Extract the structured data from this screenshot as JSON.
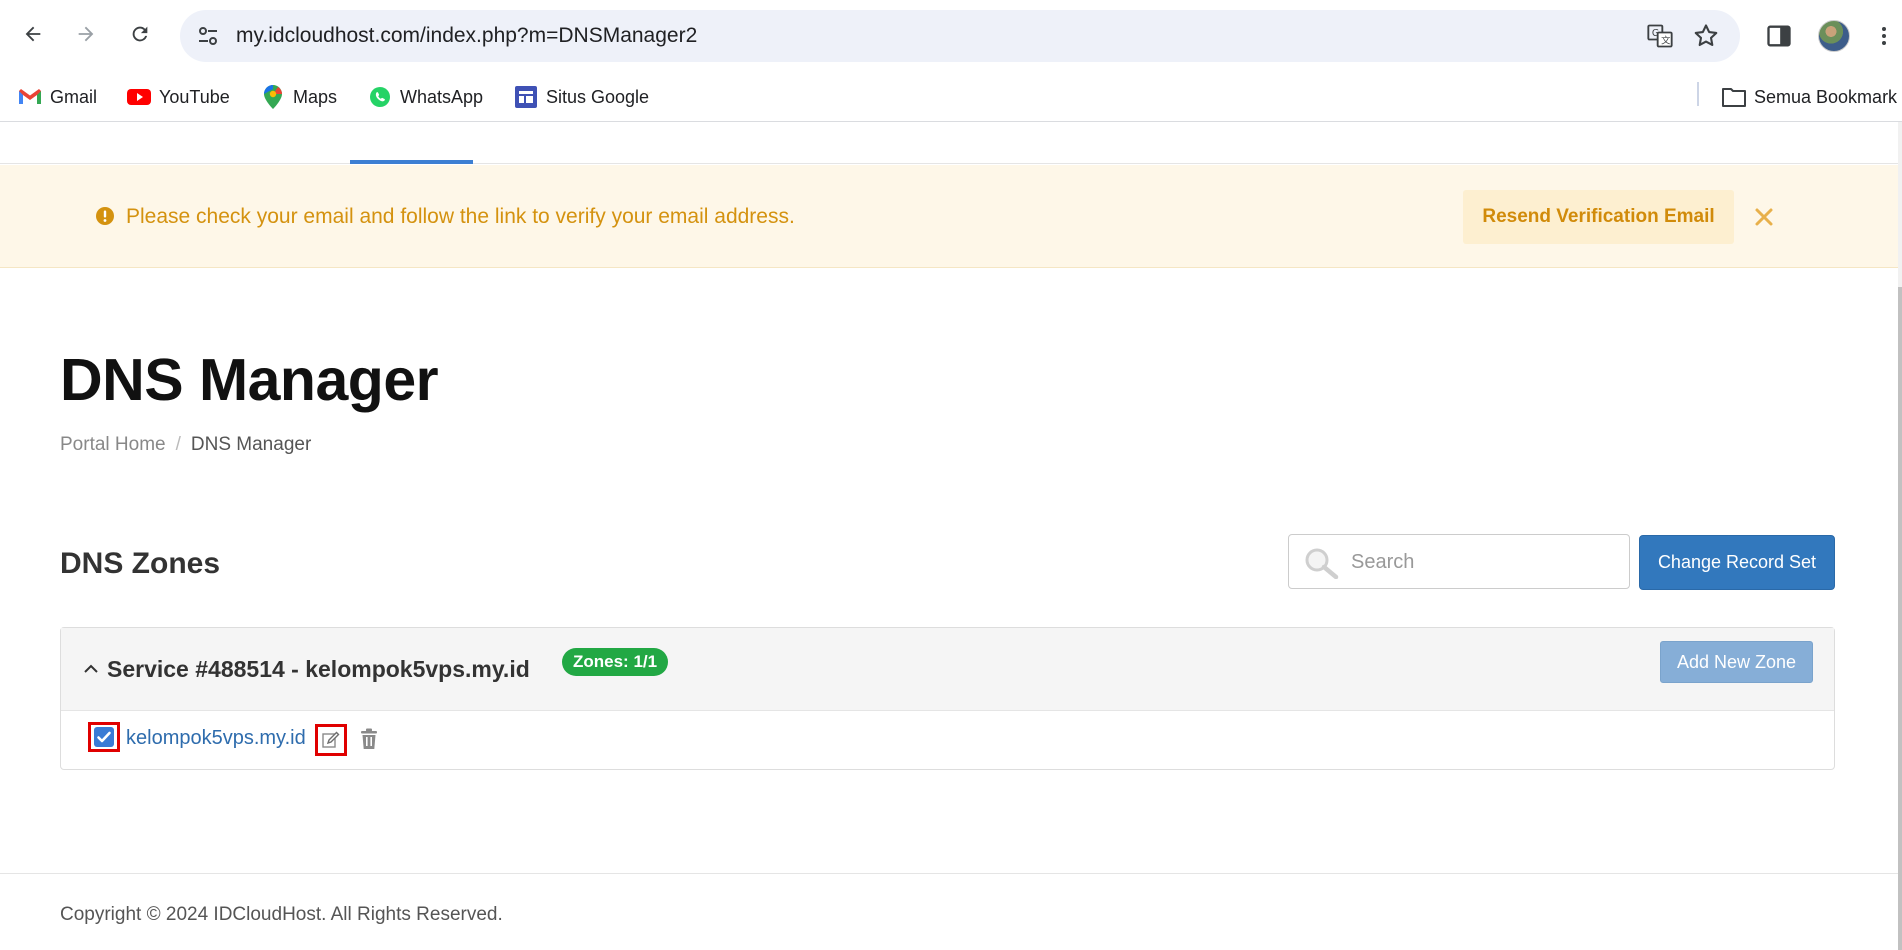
{
  "browser": {
    "url": "my.idcloudhost.com/index.php?m=DNSManager2",
    "bookmarks": [
      {
        "label": "Gmail",
        "icon": "gmail-icon"
      },
      {
        "label": "YouTube",
        "icon": "youtube-icon"
      },
      {
        "label": "Maps",
        "icon": "maps-icon"
      },
      {
        "label": "WhatsApp",
        "icon": "whatsapp-icon"
      },
      {
        "label": "Situs Google",
        "icon": "google-sites-icon"
      }
    ],
    "all_bookmarks_label": "Semua Bookmark"
  },
  "alert": {
    "message": "Please check your email and follow the link to verify your email address.",
    "resend_label": "Resend Verification Email",
    "color": "#d4920f"
  },
  "page": {
    "title": "DNS Manager",
    "breadcrumb": {
      "home": "Portal Home",
      "separator": "/",
      "current": "DNS Manager"
    }
  },
  "zones": {
    "heading": "DNS Zones",
    "search_placeholder": "Search",
    "change_record_set_label": "Change Record Set",
    "service": {
      "title": "Service #488514 - kelompok5vps.my.id",
      "badge": "Zones: 1/1",
      "add_zone_label": "Add New Zone"
    },
    "rows": [
      {
        "domain": "kelompok5vps.my.id",
        "checked": true
      }
    ]
  },
  "footer": {
    "copyright": "Copyright © 2024 IDCloudHost. All Rights Reserved."
  },
  "colors": {
    "primary_button": "#3278bd",
    "badge_green": "#22a844",
    "link_blue": "#2e6cad",
    "highlight_red": "#e00000"
  }
}
